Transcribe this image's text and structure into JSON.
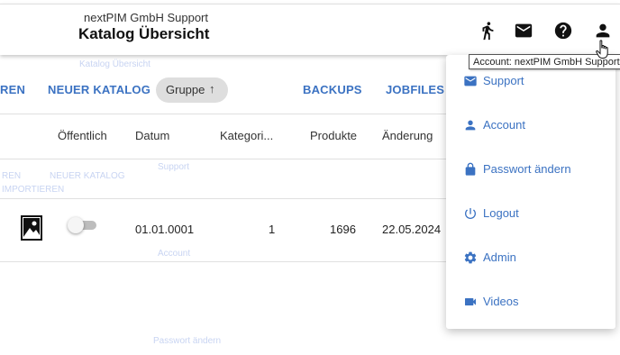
{
  "header": {
    "subtitle": "nextPIM GmbH Support",
    "title": "Katalog Übersicht",
    "icons": [
      "run-icon",
      "mail-icon",
      "help-icon",
      "account-icon"
    ]
  },
  "toolbar": {
    "cut_label": "REN",
    "new_catalog": "NEUER KATALOG",
    "group_chip": "Gruppe",
    "group_arrow": "↑",
    "backups": "BACKUPS",
    "jobfiles": "JOBFILES"
  },
  "table": {
    "headers": [
      "Öffentlich",
      "Datum",
      "Kategori...",
      "Produkte",
      "Änderung"
    ],
    "rows": [
      {
        "image_icon": "image-icon",
        "public": false,
        "date": "01.01.0001",
        "categories": "1",
        "products": "1696",
        "changed": "22.05.2024"
      }
    ]
  },
  "menu": {
    "items": [
      {
        "label": "Support",
        "icon": "mail-icon"
      },
      {
        "label": "Account",
        "icon": "person-icon"
      },
      {
        "label": "Passwort ändern",
        "icon": "lock-icon"
      },
      {
        "label": "Logout",
        "icon": "power-icon"
      },
      {
        "label": "Admin",
        "icon": "gear-icon"
      },
      {
        "label": "Videos",
        "icon": "video-icon"
      }
    ]
  },
  "tooltip": "Account: nextPIM GmbH Support",
  "ghost_text": {
    "g1": "Katalog Übersicht",
    "g2": "REN",
    "g3": "NEUER KATALOG",
    "g4": "IMPORTIEREN",
    "g5": "Support",
    "g6": "Account",
    "g7": "Passwort ändern"
  },
  "colors": {
    "accent": "#3b72c2",
    "chip_bg": "#dedede",
    "toggle_off": "#bdbdbd"
  }
}
